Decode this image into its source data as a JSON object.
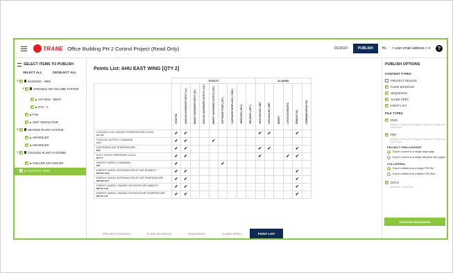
{
  "header": {
    "brand": "TRANE",
    "title": "Office Building PH 2 Control Project (Read Only)",
    "design_label": "DESIGN",
    "publish_label": "PUBLISH",
    "language": "HL",
    "email": "< user email address >",
    "help_glyph": "?"
  },
  "left": {
    "title": "SELECT ITEMS TO PUBLISH",
    "select_all": "SELECT ALL",
    "deselect_all": "DESELECT ALL",
    "tree": [
      {
        "label": "BUILDING - #565",
        "chevron": "∨",
        "level": 0
      },
      {
        "label": "VARIABLE AIR VOLUME SYSTEM",
        "chevron": "∨",
        "level": 1
      },
      {
        "label": "VAV BOX - WEST",
        "chevron": "",
        "level": 2
      },
      {
        "label": "RTU - 1",
        "chevron": "",
        "level": 2
      },
      {
        "label": "FAN",
        "chevron": "",
        "level": 1
      },
      {
        "label": "UNIT VENTILATOR",
        "chevron": "",
        "level": 1
      },
      {
        "label": "HEATING PLANT SYSTEM",
        "chevron": "∨",
        "level": 0
      },
      {
        "label": "HW BOILER",
        "chevron": "",
        "level": 1
      },
      {
        "label": "HW BOILER",
        "chevron": "",
        "level": 1
      },
      {
        "label": "COOLING PLANT SYSTEMS",
        "chevron": "∨",
        "level": 0
      },
      {
        "label": "CHILLER AIR COOLED",
        "chevron": "",
        "level": 1
      },
      {
        "label": "AHU EAST WING",
        "chevron": "›",
        "level": 0
      }
    ]
  },
  "main": {
    "title": "Points List: AHU  EAST WING [QTY 2]",
    "groups": {
      "points": "POINTS",
      "alarms": "ALARMS"
    },
    "columns": [
      "GRAPHIC",
      "ANALOG HARDWARE INPUT ( AI )",
      "BINARY HARDWARE INPUT ( BI )",
      "ANALOG HARDWARE OUTPUT ( AO )",
      "BINARY HARDWARE OUTPUT ( BO )",
      "SOFTWARE POINT ( API )",
      "HARDWARE INTERLOCK ( HDW )",
      "WIRELESS ( WLS )",
      "NETWORK ( NET )",
      "HIGH ANALOG LIMIT",
      "LOW ANALOG LIMIT",
      "BINARY",
      "LATCH DIAGNOSTIC",
      "SENSOR FAIL",
      "COMMUNICATION FAIL"
    ],
    "check_glyph": "✔",
    "rows": [
      {
        "name": "COOLING COIL LEAVING TEMPERATURE LOCAL",
        "code": "CC LAT",
        "checks": [
          1,
          1,
          0,
          0,
          0,
          0,
          0,
          0,
          0,
          1,
          1,
          0,
          0,
          1,
          0
        ]
      },
      {
        "name": "COOLING OUTPUT COMMAND",
        "code": "CLG",
        "checks": [
          1,
          1,
          0,
          0,
          1,
          0,
          0,
          0,
          0,
          0,
          0,
          0,
          0,
          0,
          0
        ]
      },
      {
        "name": "DISCHARGE AIR TEMPERATURE",
        "code": "DAT",
        "checks": [
          1,
          1,
          0,
          0,
          0,
          0,
          0,
          0,
          0,
          1,
          1,
          0,
          0,
          1,
          0
        ]
      },
      {
        "name": "DUCT STATIC PRESSURE LOCAL",
        "code": "DCT P",
        "checks": [
          1,
          1,
          0,
          0,
          0,
          0,
          0,
          0,
          0,
          1,
          0,
          0,
          1,
          1,
          0
        ]
      },
      {
        "name": "ENERGY WHEEL COMMAND",
        "code": "EW",
        "checks": [
          1,
          0,
          0,
          0,
          0,
          1,
          0,
          0,
          0,
          0,
          0,
          0,
          0,
          0,
          0
        ]
      },
      {
        "name": "ENERGY WHEEL ENTERING RELIEF AIR HUMIDITY",
        "code": "EW RLF EAH",
        "checks": [
          1,
          1,
          0,
          0,
          0,
          0,
          0,
          0,
          0,
          0,
          0,
          0,
          0,
          1,
          0
        ]
      },
      {
        "name": "ENERGY WHEEL ENTERING RELIEF AIR TEMPERATURE",
        "code": "EW RLF EAT",
        "checks": [
          1,
          1,
          0,
          0,
          0,
          0,
          0,
          0,
          0,
          0,
          0,
          0,
          0,
          1,
          0
        ]
      },
      {
        "name": "ENERGY WHEEL LEAVING OUTDOOR AIR HUMIDITY",
        "code": "EW OA LAH",
        "checks": [
          1,
          1,
          0,
          0,
          0,
          0,
          0,
          0,
          0,
          0,
          0,
          0,
          0,
          1,
          0
        ]
      },
      {
        "name": "ENERGY WHEEL LEAVING OUTDOOR AIR TEMPERATURE",
        "code": "EW OA LAT",
        "checks": [
          1,
          1,
          0,
          0,
          0,
          0,
          0,
          0,
          0,
          0,
          0,
          0,
          0,
          1,
          0
        ]
      }
    ]
  },
  "tabs": [
    "PROJECT DESIGN",
    "FLOW DIAGRAM",
    "SEQUENCE",
    "GUIDE SPEC",
    "POINT LIST"
  ],
  "active_tab": "POINT LIST",
  "right": {
    "title": "PUBLISH OPTIONS",
    "content_types_label": "CONTENT TYPES",
    "content_types": [
      {
        "label": "PROJECT DESIGN",
        "checked": false
      },
      {
        "label": "FLOW DIAGRAM",
        "checked": true
      },
      {
        "label": "SEQUENCE",
        "checked": true
      },
      {
        "label": "GUIDE SPEC",
        "checked": true
      },
      {
        "label": "POINT LIST",
        "checked": true
      }
    ],
    "file_types_label": "FILE TYPES",
    "dwg_label": "DWG",
    "dwg_hint": "Includes Content Flow Diagram, Sequence, Points List, Guide Spec",
    "pdf_label": "PDF",
    "pdf_hint": "Includes Content Flow Diagram, Sequence, Points List, Guide Spec",
    "project_item_content_label": "PROJECT ITEM CONTENT",
    "project_item_options": [
      {
        "label": "Export content to a single large page",
        "selected": true
      },
      {
        "label": "Export content to multiple standard size pages",
        "selected": false
      }
    ],
    "collateral_label": "COLLATERAL",
    "collateral_options": [
      {
        "label": "Export collateral as a single PDF file",
        "selected": true
      },
      {
        "label": "Export collateral as multiple PDF files",
        "selected": false
      }
    ],
    "docx_label": "DOCX",
    "docx_hint": "Sequence, Guide Spec",
    "generate_label": "Generate Documents"
  },
  "colors": {
    "accent_green": "#8cc63f",
    "navy": "#0d2b55",
    "brand_red": "#e31b23"
  }
}
